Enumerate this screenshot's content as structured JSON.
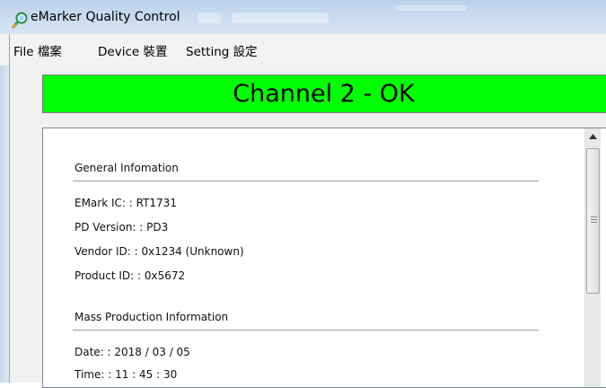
{
  "window": {
    "title": "eMarker Quality Control",
    "icon": "magnifier-app-icon"
  },
  "menu": {
    "items": [
      {
        "label": "File 檔案"
      },
      {
        "label": "Device 裝置"
      },
      {
        "label": "Setting 設定"
      }
    ]
  },
  "status": {
    "text": "Channel 2 - OK",
    "color": "#00ff00"
  },
  "general": {
    "title": "General Infomation",
    "emark_ic": "EMark IC: : RT1731",
    "pd_version": "PD Version: : PD3",
    "vendor_id": "Vendor ID: : 0x1234 (Unknown)",
    "product_id": "Product ID: : 0x5672"
  },
  "mass_production": {
    "title": "Mass Production Information",
    "date": "Date: : 2018 / 03 / 05",
    "time": "Time: : 11 : 45 : 30"
  },
  "scrollbar": {
    "up_icon": "scroll-up-arrow-icon",
    "grip_icon": "scroll-grip-icon"
  }
}
